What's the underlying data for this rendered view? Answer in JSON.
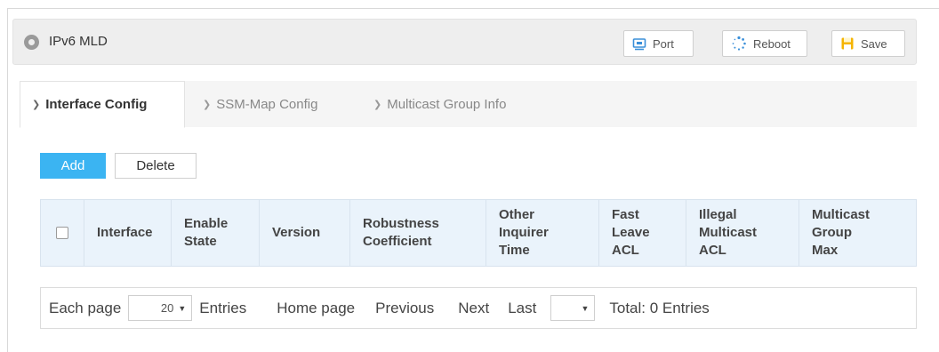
{
  "header": {
    "title": "IPv6 MLD",
    "buttons": {
      "port": "Port",
      "reboot": "Reboot",
      "save": "Save"
    }
  },
  "tabs": [
    {
      "label": "Interface Config",
      "active": true
    },
    {
      "label": "SSM-Map Config",
      "active": false
    },
    {
      "label": "Multicast Group Info",
      "active": false
    }
  ],
  "actions": {
    "add": "Add",
    "delete": "Delete"
  },
  "table": {
    "columns": [
      [
        "Interface"
      ],
      [
        "Enable",
        "State"
      ],
      [
        "Version"
      ],
      [
        "Robustness",
        "Coefficient"
      ],
      [
        "Other",
        "Inquirer",
        "Time"
      ],
      [
        "Fast",
        "Leave",
        "ACL"
      ],
      [
        "Illegal",
        "Multicast",
        "ACL"
      ],
      [
        "Multicast",
        "Group",
        "Max"
      ]
    ],
    "rows": []
  },
  "pager": {
    "each_page": "Each page",
    "page_size": "20",
    "entries": "Entries",
    "home": "Home page",
    "previous": "Previous",
    "next": "Next",
    "last": "Last",
    "current_page": "",
    "total": "Total: 0 Entries"
  },
  "colors": {
    "accent": "#3bb4f2",
    "header_bg": "#eeeeee",
    "table_header_bg": "#eaf3fb"
  }
}
